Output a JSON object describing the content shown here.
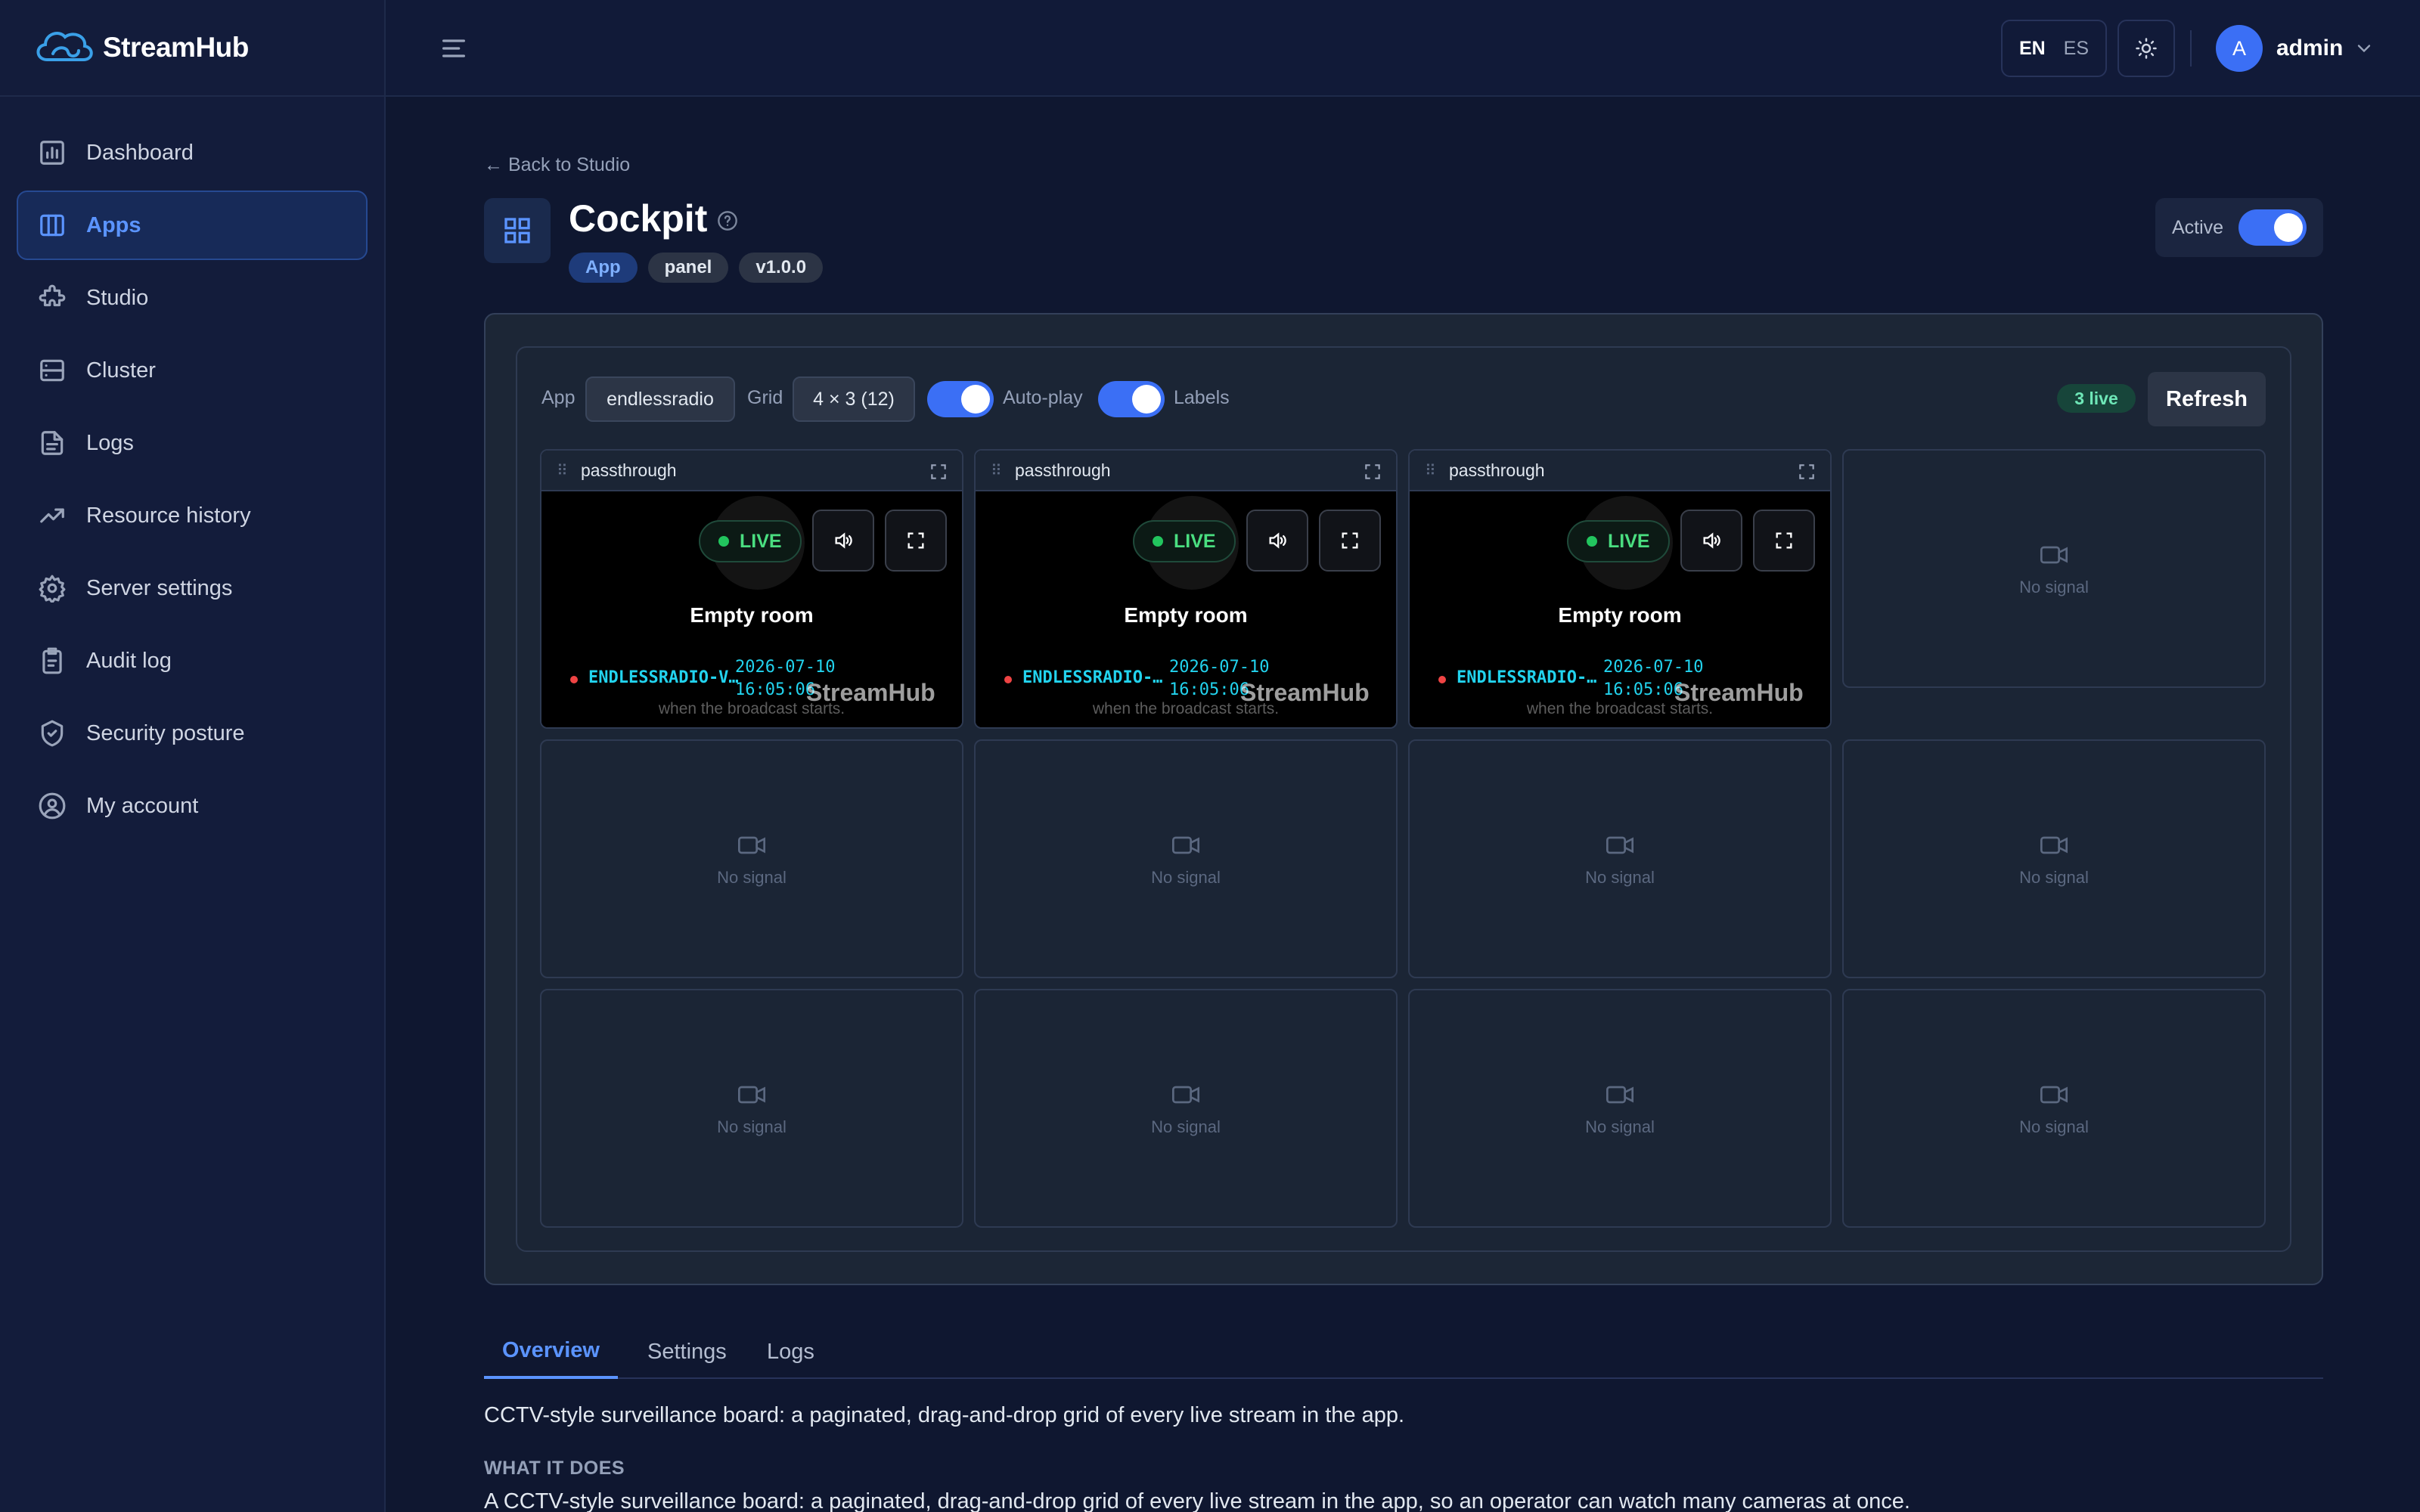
{
  "brand": {
    "name": "StreamHub"
  },
  "sidebar": {
    "items": [
      {
        "label": "Dashboard",
        "icon": "dashboard-icon",
        "active": false
      },
      {
        "label": "Apps",
        "icon": "apps-icon",
        "active": true
      },
      {
        "label": "Studio",
        "icon": "puzzle-icon",
        "active": false
      },
      {
        "label": "Cluster",
        "icon": "server-icon",
        "active": false
      },
      {
        "label": "Logs",
        "icon": "file-icon",
        "active": false
      },
      {
        "label": "Resource history",
        "icon": "trending-icon",
        "active": false
      },
      {
        "label": "Server settings",
        "icon": "gear-icon",
        "active": false
      },
      {
        "label": "Audit log",
        "icon": "clipboard-icon",
        "active": false
      },
      {
        "label": "Security posture",
        "icon": "shield-icon",
        "active": false
      },
      {
        "label": "My account",
        "icon": "user-circle-icon",
        "active": false
      }
    ]
  },
  "topbar": {
    "languages": [
      "EN",
      "ES"
    ],
    "active_language": "EN",
    "user": {
      "initial": "A",
      "name": "admin"
    }
  },
  "header": {
    "back_link": "← Back to Studio",
    "title": "Cockpit",
    "tags": [
      "App",
      "panel",
      "v1.0.0"
    ],
    "active_label": "Active",
    "active_on": true
  },
  "toolbar": {
    "app_label": "App",
    "app_value": "endlessradio",
    "grid_label": "Grid",
    "grid_value": "4 × 3 (12)",
    "autoplay_label": "Auto-play",
    "autoplay_on": true,
    "labels_label": "Labels",
    "labels_on": true,
    "live_count": "3 live",
    "refresh_label": "Refresh"
  },
  "tiles": {
    "streams": [
      {
        "name": "passthrough",
        "live": "LIVE",
        "status": "Empty room",
        "note": "when the broadcast starts.",
        "title": "ENDLESSRADIO-V…",
        "date": "2026-07-10",
        "time": "16:05:06",
        "watermark": "StreamHub"
      },
      {
        "name": "passthrough",
        "live": "LIVE",
        "status": "Empty room",
        "note": "when the broadcast starts.",
        "title": "ENDLESSRADIO-…",
        "date": "2026-07-10",
        "time": "16:05:06",
        "watermark": "StreamHub"
      },
      {
        "name": "passthrough",
        "live": "LIVE",
        "status": "Empty room",
        "note": "when the broadcast starts.",
        "title": "ENDLESSRADIO-…",
        "date": "2026-07-10",
        "time": "16:05:06",
        "watermark": "StreamHub"
      }
    ],
    "empty_label": "No signal"
  },
  "tabs": [
    "Overview",
    "Settings",
    "Logs"
  ],
  "active_tab": "Overview",
  "overview": {
    "summary": "CCTV-style surveillance board: a paginated, drag-and-drop grid of every live stream in the app.",
    "section_heading": "WHAT IT DOES",
    "section_text": "A CCTV-style surveillance board: a paginated, drag-and-drop grid of every live stream in the app, so an operator can watch many cameras at once."
  },
  "colors": {
    "accent": "#3b6ff5",
    "live": "#22c55e",
    "stream_text": "#22d3ee"
  }
}
